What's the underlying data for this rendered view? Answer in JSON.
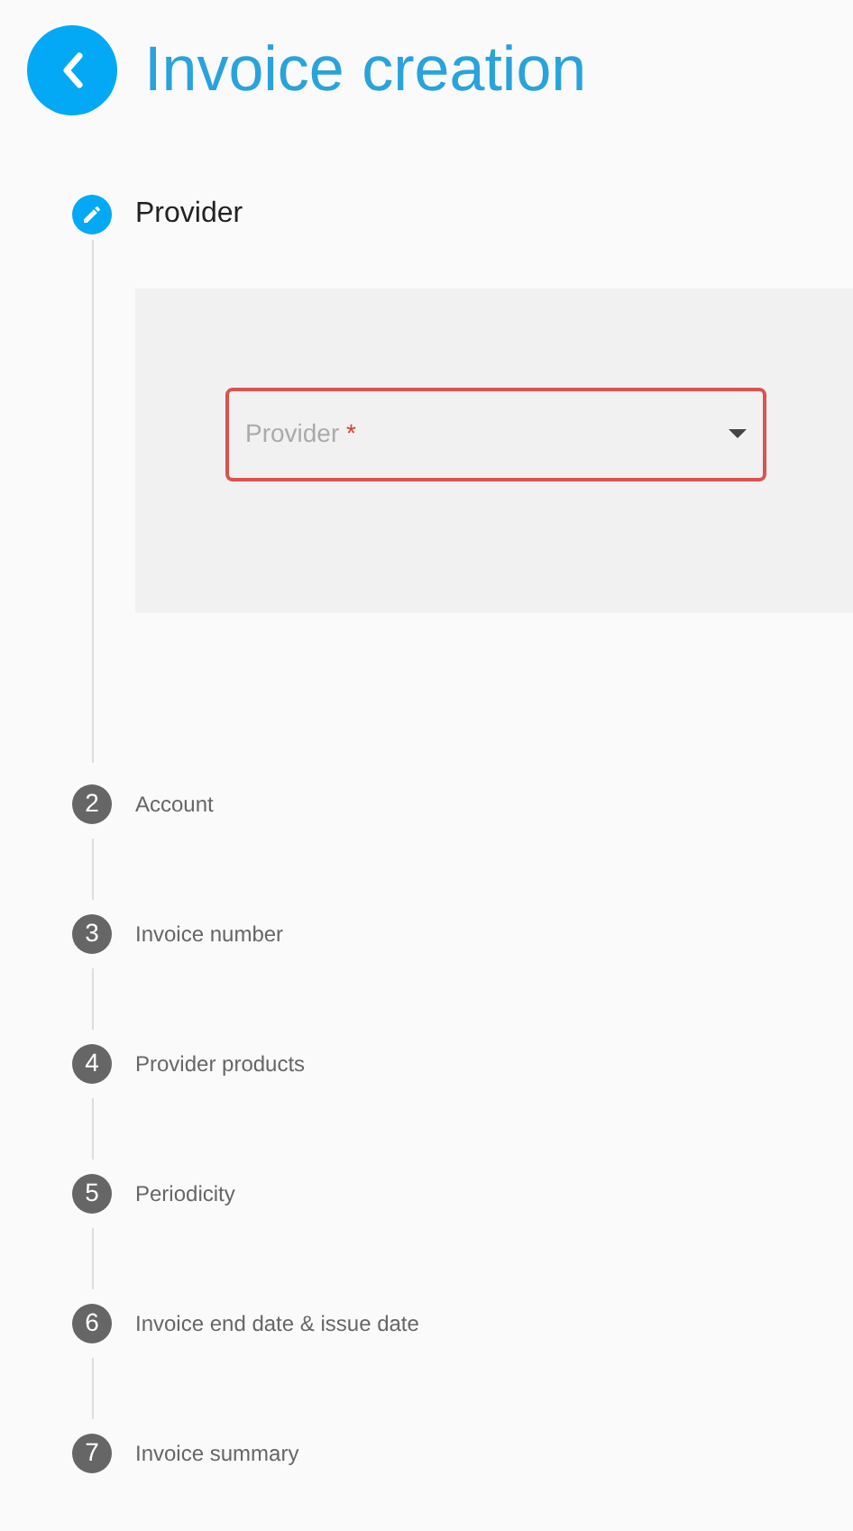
{
  "header": {
    "title": "Invoice creation"
  },
  "steps": [
    {
      "label": "Provider",
      "active": true,
      "field": {
        "placeholder": "Provider",
        "required_mark": "*",
        "error": true
      }
    },
    {
      "label": "Account",
      "number": "2",
      "active": false
    },
    {
      "label": "Invoice number",
      "number": "3",
      "active": false
    },
    {
      "label": "Provider products",
      "number": "4",
      "active": false
    },
    {
      "label": "Periodicity",
      "number": "5",
      "active": false
    },
    {
      "label": "Invoice end date & issue date",
      "number": "6",
      "active": false
    },
    {
      "label": "Invoice summary",
      "number": "7",
      "active": false
    }
  ]
}
